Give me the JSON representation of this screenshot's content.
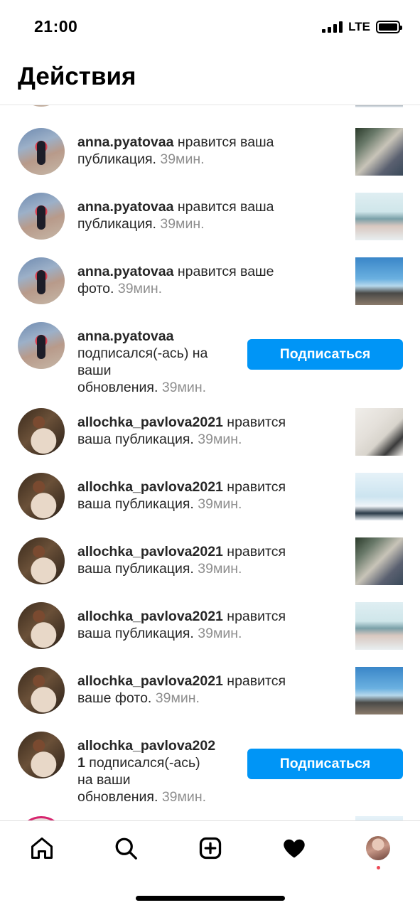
{
  "status_bar": {
    "time": "21:00",
    "network": "LTE",
    "battery_level": 1.0
  },
  "header": {
    "title": "Действия"
  },
  "notifications": [
    {
      "avatar": "anna",
      "user": "anna.pyatovaa",
      "lines": [
        "{user} нравится ваша",
        "публикация. {time}"
      ],
      "time": "39мин.",
      "action": "нравится ваша публикация.",
      "thumbnail": "kitchen-photo"
    },
    {
      "avatar": "anna",
      "user": "anna.pyatovaa",
      "lines": [
        "{user} нравится ваша",
        "публикация. {time}"
      ],
      "time": "39мин.",
      "action": "нравится ваша публикация.",
      "thumbnail": "group-photo"
    },
    {
      "avatar": "anna",
      "user": "anna.pyatovaa",
      "lines": [
        "{user} нравится ваше",
        "фото. {time}"
      ],
      "time": "39мин.",
      "action": "нравится ваше фото.",
      "thumbnail": "sky-photo"
    },
    {
      "avatar": "anna",
      "user": "anna.pyatovaa",
      "lines": [
        "{user}",
        "подписался(-ась) на",
        "ваши",
        "обновления. {time}"
      ],
      "time": "39мин.",
      "action": "подписался(-ась) на ваши обновления.",
      "button": "Подписаться"
    },
    {
      "avatar": "allochka",
      "user": "allochka_pavlova2021",
      "lines": [
        "{user} нравится",
        "ваша публикация. {time}"
      ],
      "time": "39мин.",
      "action": "нравится ваша публикация.",
      "thumbnail": "girl-photo"
    },
    {
      "avatar": "allochka",
      "user": "allochka_pavlova2021",
      "lines": [
        "{user} нравится",
        "ваша публикация. {time}"
      ],
      "time": "39мин.",
      "action": "нравится ваша публикация.",
      "thumbnail": "studio-photo"
    },
    {
      "avatar": "allochka",
      "user": "allochka_pavlova2021",
      "lines": [
        "{user} нравится",
        "ваша публикация. {time}"
      ],
      "time": "39мин.",
      "action": "нравится ваша публикация.",
      "thumbnail": "kitchen-photo"
    },
    {
      "avatar": "allochka",
      "user": "allochka_pavlova2021",
      "lines": [
        "{user} нравится",
        "ваша публикация. {time}"
      ],
      "time": "39мин.",
      "action": "нравится ваша публикация.",
      "thumbnail": "group-photo"
    },
    {
      "avatar": "allochka",
      "user": "allochka_pavlova2021",
      "lines": [
        "{user} нравится",
        "ваше фото. {time}"
      ],
      "time": "39мин.",
      "action": "нравится ваше фото.",
      "thumbnail": "sky-photo"
    },
    {
      "avatar": "allochka",
      "user": "allochka_pavlova202",
      "user_tail": "1",
      "lines": [
        "{user}",
        "{user_tail} подписался(-ась)",
        "на ваши",
        "обновления. {time}"
      ],
      "time": "39мин.",
      "action": "подписался(-ась) на ваши обновления.",
      "button": "Подписаться"
    }
  ],
  "tab_bar": {
    "items": [
      {
        "name": "home",
        "icon": "home-icon"
      },
      {
        "name": "search",
        "icon": "search-icon"
      },
      {
        "name": "new-post",
        "icon": "plus-square-icon"
      },
      {
        "name": "activity",
        "icon": "heart-filled-icon",
        "active": true
      },
      {
        "name": "profile",
        "icon": "profile-avatar"
      }
    ]
  },
  "colors": {
    "accent": "#0095f6",
    "muted_text": "#8e8e8e",
    "notification_dot": "#ed4956"
  }
}
